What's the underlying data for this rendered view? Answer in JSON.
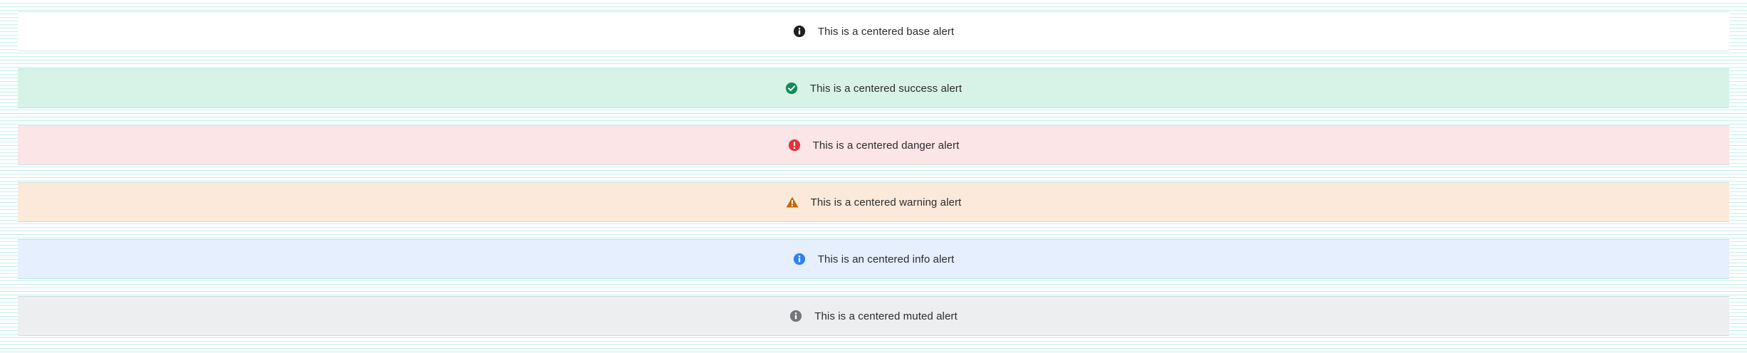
{
  "alerts": [
    {
      "kind": "base",
      "icon": "info-icon",
      "color": "#1f1f1f",
      "text": "This is a centered base alert"
    },
    {
      "kind": "success",
      "icon": "check-circle-icon",
      "color": "#138a5b",
      "text": "This is a centered success alert"
    },
    {
      "kind": "danger",
      "icon": "exclamation-circle-icon",
      "color": "#e5313b",
      "text": "This is a centered danger alert"
    },
    {
      "kind": "warning",
      "icon": "warning-triangle-icon",
      "color": "#c7650c",
      "text": "This is a centered warning alert"
    },
    {
      "kind": "info",
      "icon": "info-icon",
      "color": "#2f7ff0",
      "text": "This is an centered info alert"
    },
    {
      "kind": "muted",
      "icon": "info-icon",
      "color": "#73767a",
      "text": "This is a centered muted alert"
    }
  ]
}
